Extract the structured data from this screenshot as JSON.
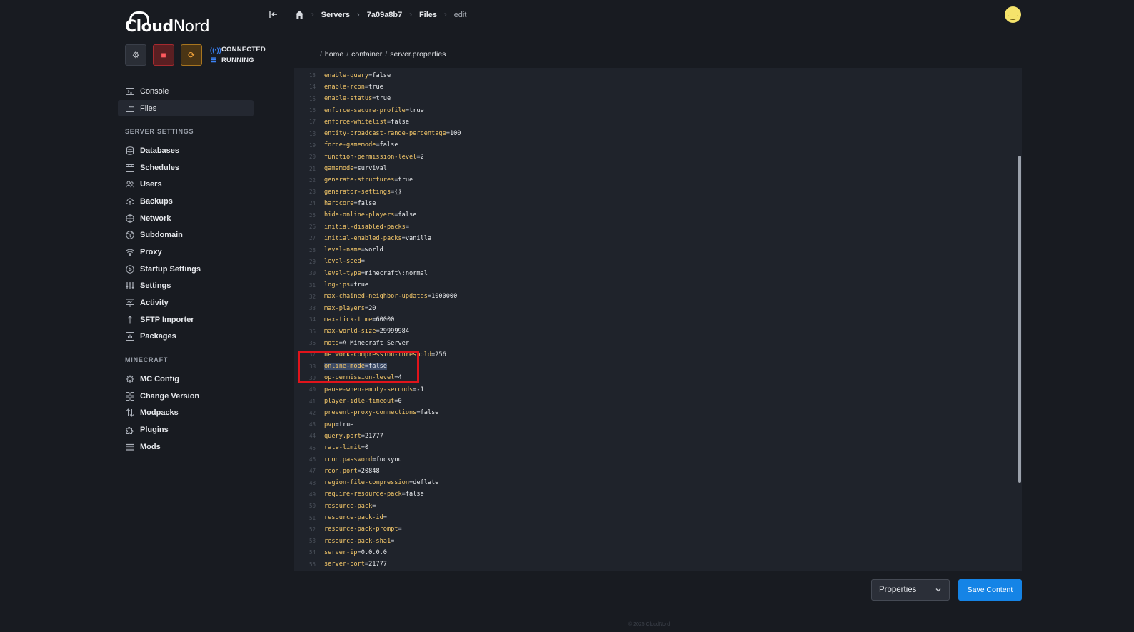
{
  "brand": {
    "logo_text_bold": "Cloud",
    "logo_text_light": "Nord"
  },
  "status": {
    "connection": "CONNECTED",
    "server": "RUNNING"
  },
  "nav": {
    "items": [
      {
        "label": "Console",
        "icon": "terminal-icon"
      },
      {
        "label": "Files",
        "icon": "folder-icon",
        "active": true
      }
    ],
    "server_settings_title": "SERVER SETTINGS",
    "server_settings": [
      {
        "label": "Databases",
        "icon": "database-icon"
      },
      {
        "label": "Schedules",
        "icon": "calendar-icon"
      },
      {
        "label": "Users",
        "icon": "users-icon"
      },
      {
        "label": "Backups",
        "icon": "cloud-upload-icon"
      },
      {
        "label": "Network",
        "icon": "globe-icon"
      },
      {
        "label": "Subdomain",
        "icon": "globe-alt-icon"
      },
      {
        "label": "Proxy",
        "icon": "wifi-icon"
      },
      {
        "label": "Startup Settings",
        "icon": "play-circle-icon"
      },
      {
        "label": "Settings",
        "icon": "sliders-icon"
      },
      {
        "label": "Activity",
        "icon": "monitor-icon"
      },
      {
        "label": "SFTP Importer",
        "icon": "arrow-up-icon"
      },
      {
        "label": "Packages",
        "icon": "chart-box-icon"
      }
    ],
    "minecraft_title": "MINECRAFT",
    "minecraft": [
      {
        "label": "MC Config",
        "icon": "gear-icon"
      },
      {
        "label": "Change Version",
        "icon": "grid-icon"
      },
      {
        "label": "Modpacks",
        "icon": "arrows-updown-icon"
      },
      {
        "label": "Plugins",
        "icon": "puzzle-icon"
      },
      {
        "label": "Mods",
        "icon": "list-icon"
      }
    ]
  },
  "breadcrumb": {
    "servers": "Servers",
    "server_id": "7a09a8b7",
    "files": "Files",
    "current": "edit"
  },
  "file_path": {
    "seg1": "home",
    "seg2": "container",
    "seg3": "server.properties"
  },
  "editor": {
    "lines": [
      {
        "n": "13",
        "k": "enable-query",
        "v": "false"
      },
      {
        "n": "14",
        "k": "enable-rcon",
        "v": "true"
      },
      {
        "n": "15",
        "k": "enable-status",
        "v": "true"
      },
      {
        "n": "16",
        "k": "enforce-secure-profile",
        "v": "true"
      },
      {
        "n": "17",
        "k": "enforce-whitelist",
        "v": "false"
      },
      {
        "n": "18",
        "k": "entity-broadcast-range-percentage",
        "v": "100"
      },
      {
        "n": "19",
        "k": "force-gamemode",
        "v": "false"
      },
      {
        "n": "20",
        "k": "function-permission-level",
        "v": "2"
      },
      {
        "n": "21",
        "k": "gamemode",
        "v": "survival"
      },
      {
        "n": "22",
        "k": "generate-structures",
        "v": "true"
      },
      {
        "n": "23",
        "k": "generator-settings",
        "v": "{}"
      },
      {
        "n": "24",
        "k": "hardcore",
        "v": "false"
      },
      {
        "n": "25",
        "k": "hide-online-players",
        "v": "false"
      },
      {
        "n": "26",
        "k": "initial-disabled-packs",
        "v": ""
      },
      {
        "n": "27",
        "k": "initial-enabled-packs",
        "v": "vanilla"
      },
      {
        "n": "28",
        "k": "level-name",
        "v": "world"
      },
      {
        "n": "29",
        "k": "level-seed",
        "v": ""
      },
      {
        "n": "30",
        "k": "level-type",
        "v": "minecraft\\:normal"
      },
      {
        "n": "31",
        "k": "log-ips",
        "v": "true"
      },
      {
        "n": "32",
        "k": "max-chained-neighbor-updates",
        "v": "1000000"
      },
      {
        "n": "33",
        "k": "max-players",
        "v": "20"
      },
      {
        "n": "34",
        "k": "max-tick-time",
        "v": "60000"
      },
      {
        "n": "35",
        "k": "max-world-size",
        "v": "29999984"
      },
      {
        "n": "36",
        "k": "motd",
        "v": "A Minecraft Server"
      },
      {
        "n": "37",
        "k": "network-compression-threshold",
        "v": "256"
      },
      {
        "n": "38",
        "k": "online-mode",
        "v": "false",
        "selected": true
      },
      {
        "n": "39",
        "k": "op-permission-level",
        "v": "4"
      },
      {
        "n": "40",
        "k": "pause-when-empty-seconds",
        "v": "-1"
      },
      {
        "n": "41",
        "k": "player-idle-timeout",
        "v": "0"
      },
      {
        "n": "42",
        "k": "prevent-proxy-connections",
        "v": "false"
      },
      {
        "n": "43",
        "k": "pvp",
        "v": "true"
      },
      {
        "n": "44",
        "k": "query.port",
        "v": "21777"
      },
      {
        "n": "45",
        "k": "rate-limit",
        "v": "0"
      },
      {
        "n": "46",
        "k": "rcon.password",
        "v": "fuckyou"
      },
      {
        "n": "47",
        "k": "rcon.port",
        "v": "20848"
      },
      {
        "n": "48",
        "k": "region-file-compression",
        "v": "deflate"
      },
      {
        "n": "49",
        "k": "require-resource-pack",
        "v": "false"
      },
      {
        "n": "50",
        "k": "resource-pack",
        "v": ""
      },
      {
        "n": "51",
        "k": "resource-pack-id",
        "v": ""
      },
      {
        "n": "52",
        "k": "resource-pack-prompt",
        "v": ""
      },
      {
        "n": "53",
        "k": "resource-pack-sha1",
        "v": ""
      },
      {
        "n": "54",
        "k": "server-ip",
        "v": "0.0.0.0"
      },
      {
        "n": "55",
        "k": "server-port",
        "v": "21777"
      }
    ]
  },
  "controls": {
    "language": "Properties",
    "save_label": "Save Content"
  },
  "footer": {
    "text": "© 2025 CloudNord"
  },
  "colors": {
    "accent": "#1584e6",
    "key": "#f6c96a",
    "highlight": "#e0141b",
    "stop": "#ff5a5f",
    "restart": "#f2a33a"
  }
}
